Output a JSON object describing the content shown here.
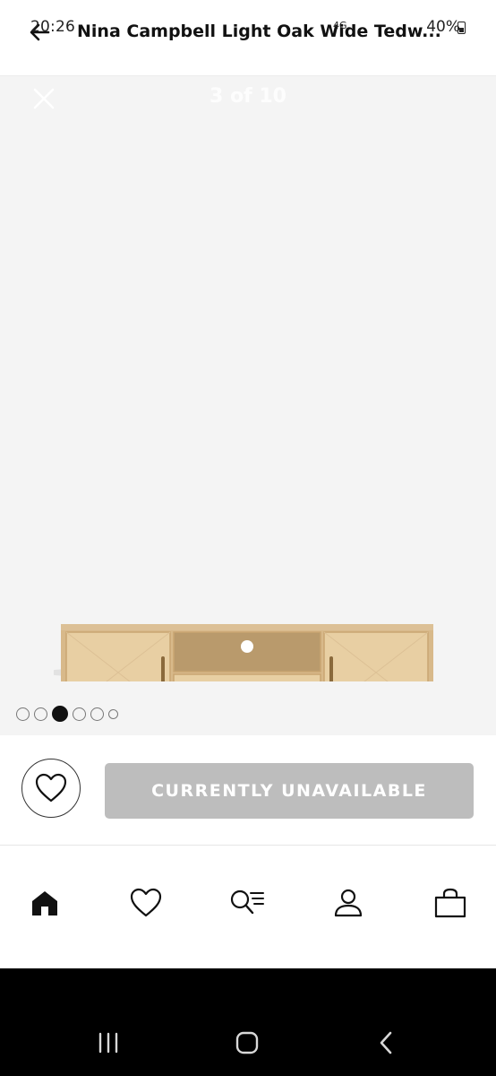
{
  "status_bar": {
    "time": "20:26",
    "network": "4G",
    "battery": "40%"
  },
  "header": {
    "title": "Nina Campbell Light Oak Wide Tedw..."
  },
  "gallery": {
    "counter": "3 of 10",
    "image_alt": "TV media unit in light oak",
    "total_images": 6,
    "active_index": 2
  },
  "actions": {
    "unavailable_label": "CURRENTLY UNAVAILABLE"
  },
  "icons": {
    "back": "back-arrow-icon",
    "close": "close-icon",
    "wishlist": "heart-icon",
    "home": "home-icon",
    "favourites": "heart-icon",
    "browse": "search-list-icon",
    "account": "person-icon",
    "basket": "bag-icon",
    "recents": "recent-apps-icon",
    "system_home": "system-home-icon",
    "system_back": "system-back-icon"
  },
  "colors": {
    "gallery_bg": "#f4f4f4",
    "button_disabled": "#bdbdbd",
    "oak_light": "#e9cfa3",
    "oak_mid": "#d9b98a"
  }
}
